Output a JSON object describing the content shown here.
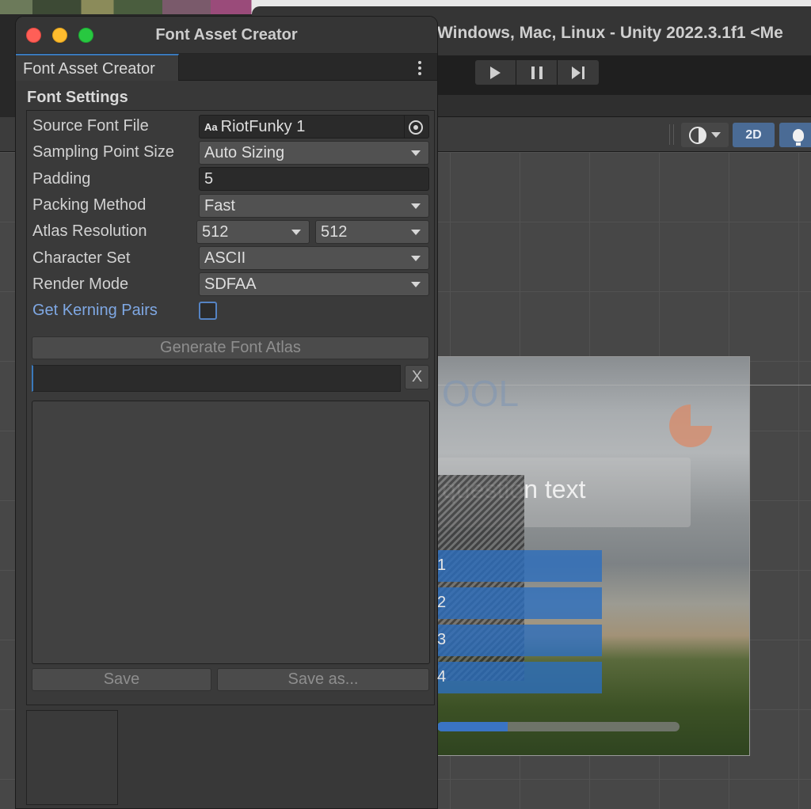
{
  "background_editor": {
    "title": "Windows, Mac, Linux - Unity 2022.3.1f1 <Me",
    "play_controls": [
      "play-icon",
      "pause-icon",
      "step-icon"
    ],
    "scene_toolbar": {
      "mode_2d_label": "2D",
      "gizmo_icon": "circle-half-icon",
      "light_icon": "lightbulb-icon"
    },
    "game_view": {
      "header_text": "OOL",
      "question_text": "question text",
      "answer_labels": [
        "1",
        "2",
        "3",
        "4"
      ],
      "progress_fraction": 0.29,
      "timer_fill_fraction": 0.75
    }
  },
  "window": {
    "title": "Font Asset Creator",
    "tab_label": "Font Asset Creator",
    "menu_icon": "kebab-menu-icon"
  },
  "font_settings": {
    "section_title": "Font Settings",
    "source_font_file": {
      "label": "Source Font File",
      "value": "RiotFunky 1",
      "icon_text": "Aa"
    },
    "sampling_point_size": {
      "label": "Sampling Point Size",
      "value": "Auto Sizing"
    },
    "padding": {
      "label": "Padding",
      "value": "5"
    },
    "packing_method": {
      "label": "Packing Method",
      "value": "Fast"
    },
    "atlas_resolution": {
      "label": "Atlas Resolution",
      "width": "512",
      "height": "512"
    },
    "character_set": {
      "label": "Character Set",
      "value": "ASCII"
    },
    "render_mode": {
      "label": "Render Mode",
      "value": "SDFAA"
    },
    "get_kerning_pairs": {
      "label": "Get Kerning Pairs",
      "checked": false
    }
  },
  "actions": {
    "generate_label": "Generate Font Atlas",
    "clear_label": "X",
    "save_label": "Save",
    "save_as_label": "Save as..."
  },
  "colors": {
    "accent_blue": "#3a79bb",
    "link_blue": "#7fa8e4",
    "window_bg": "#383838",
    "traffic_red": "#ff5f57",
    "traffic_yellow": "#febc2e",
    "traffic_green": "#28c840",
    "mode_button": "#4a6b95"
  }
}
